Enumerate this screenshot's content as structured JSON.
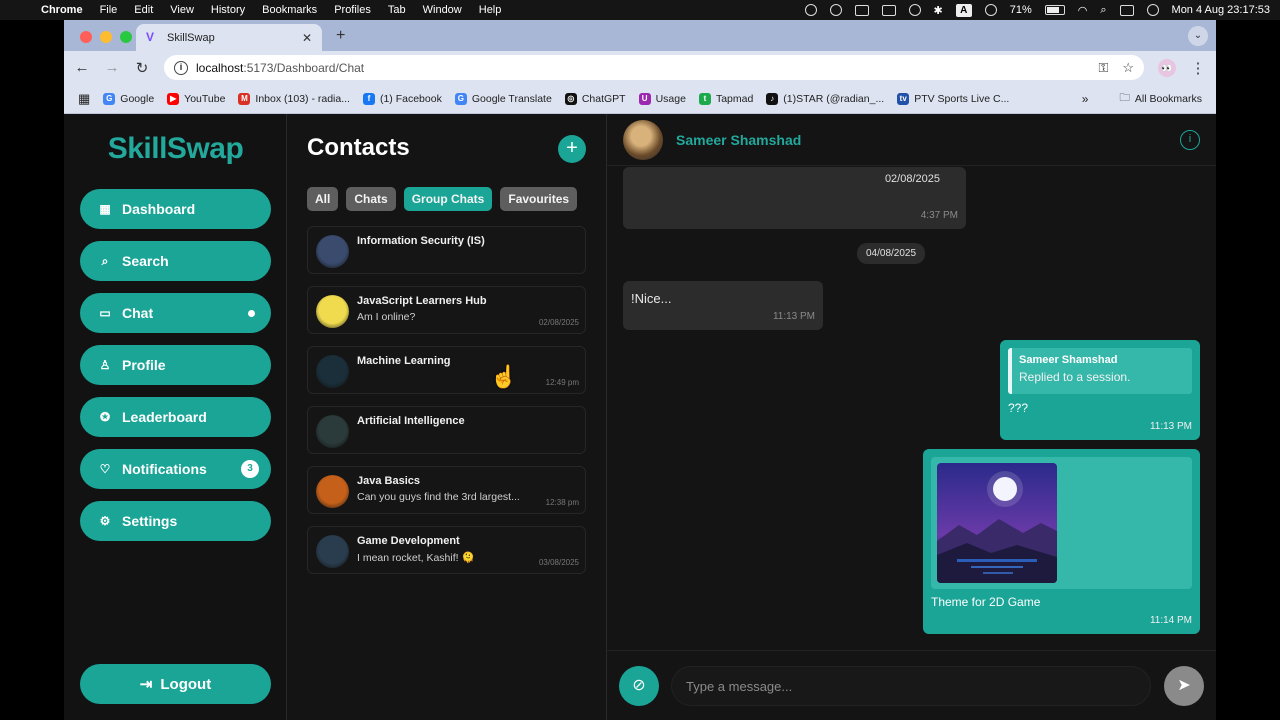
{
  "menubar": {
    "app": "Chrome",
    "menus": [
      "File",
      "Edit",
      "View",
      "History",
      "Bookmarks",
      "Profiles",
      "Tab",
      "Window",
      "Help"
    ],
    "battery": "71%",
    "clock": "Mon 4 Aug  23:17:53",
    "input_source": "A"
  },
  "browser": {
    "tab_title": "SkillSwap",
    "url_host": "localhost",
    "url_path": ":5173/Dashboard/Chat",
    "bookmarks": [
      {
        "label": "Google",
        "color": "#4285f4",
        "glyph": "G"
      },
      {
        "label": "YouTube",
        "color": "#ff0000",
        "glyph": "▶"
      },
      {
        "label": "Inbox (103) - radia...",
        "color": "#d93025",
        "glyph": "M"
      },
      {
        "label": "(1) Facebook",
        "color": "#1877f2",
        "glyph": "f"
      },
      {
        "label": "Google Translate",
        "color": "#4285f4",
        "glyph": "G"
      },
      {
        "label": "ChatGPT",
        "color": "#111111",
        "glyph": "◎"
      },
      {
        "label": "Usage",
        "color": "#9c27b0",
        "glyph": "U"
      },
      {
        "label": "Tapmad",
        "color": "#1ba94c",
        "glyph": "t"
      },
      {
        "label": "(1)STAR (@radian_...",
        "color": "#111111",
        "glyph": "♪"
      },
      {
        "label": "PTV Sports Live C...",
        "color": "#2151a8",
        "glyph": "tv"
      }
    ],
    "all_bookmarks": "All Bookmarks"
  },
  "sidebar": {
    "logo": "SkillSwap",
    "items": [
      {
        "label": "Dashboard",
        "icon": "grid-icon",
        "glyph": "▦"
      },
      {
        "label": "Search",
        "icon": "search-icon",
        "glyph": "⌕"
      },
      {
        "label": "Chat",
        "icon": "chat-icon",
        "glyph": "▭"
      },
      {
        "label": "Profile",
        "icon": "user-icon",
        "glyph": "♙"
      },
      {
        "label": "Leaderboard",
        "icon": "medal-icon",
        "glyph": "✪"
      },
      {
        "label": "Notifications",
        "icon": "heart-icon",
        "glyph": "♡",
        "badge": "3"
      },
      {
        "label": "Settings",
        "icon": "gear-icon",
        "glyph": "⚙"
      }
    ],
    "logout": "Logout"
  },
  "contacts": {
    "title": "Contacts",
    "filters": [
      {
        "label": "All",
        "active": false
      },
      {
        "label": "Chats",
        "active": false
      },
      {
        "label": "Group Chats",
        "active": true
      },
      {
        "label": "Favourites",
        "active": false
      }
    ],
    "list": [
      {
        "name": "Information Security (IS)",
        "message": "",
        "time": "",
        "color": "#3a4b6e"
      },
      {
        "name": "JavaScript Learners Hub",
        "message": "Am I online?",
        "time": "02/08/2025",
        "color": "#f0db4f"
      },
      {
        "name": "Machine Learning",
        "message": "",
        "time": "12:49 pm",
        "color": "#1b2f3a"
      },
      {
        "name": "Artificial Intelligence",
        "message": "",
        "time": "",
        "color": "#2b3a3a"
      },
      {
        "name": "Java Basics",
        "message": "Can you guys find the 3rd largest...",
        "time": "12:38 pm",
        "color": "#c4601a"
      },
      {
        "name": "Game Development",
        "message": "I mean rocket, Kashif! 🫠",
        "time": "03/08/2025",
        "color": "#2a3d4e"
      }
    ]
  },
  "chat": {
    "contact_name": "Sameer Shamshad",
    "messages": {
      "first": {
        "date": "02/08/2025",
        "time": "4:37 PM"
      },
      "date_separator": "04/08/2025",
      "nice": {
        "text": "!Nice...",
        "time": "11:13 PM"
      },
      "reply": {
        "quoted_name": "Sameer Shamshad",
        "quoted_text": "Replied to a session.",
        "text": "???",
        "time": "11:13 PM"
      },
      "image": {
        "caption": "Theme for 2D Game",
        "time": "11:14 PM"
      }
    },
    "composer_placeholder": "Type a message..."
  }
}
